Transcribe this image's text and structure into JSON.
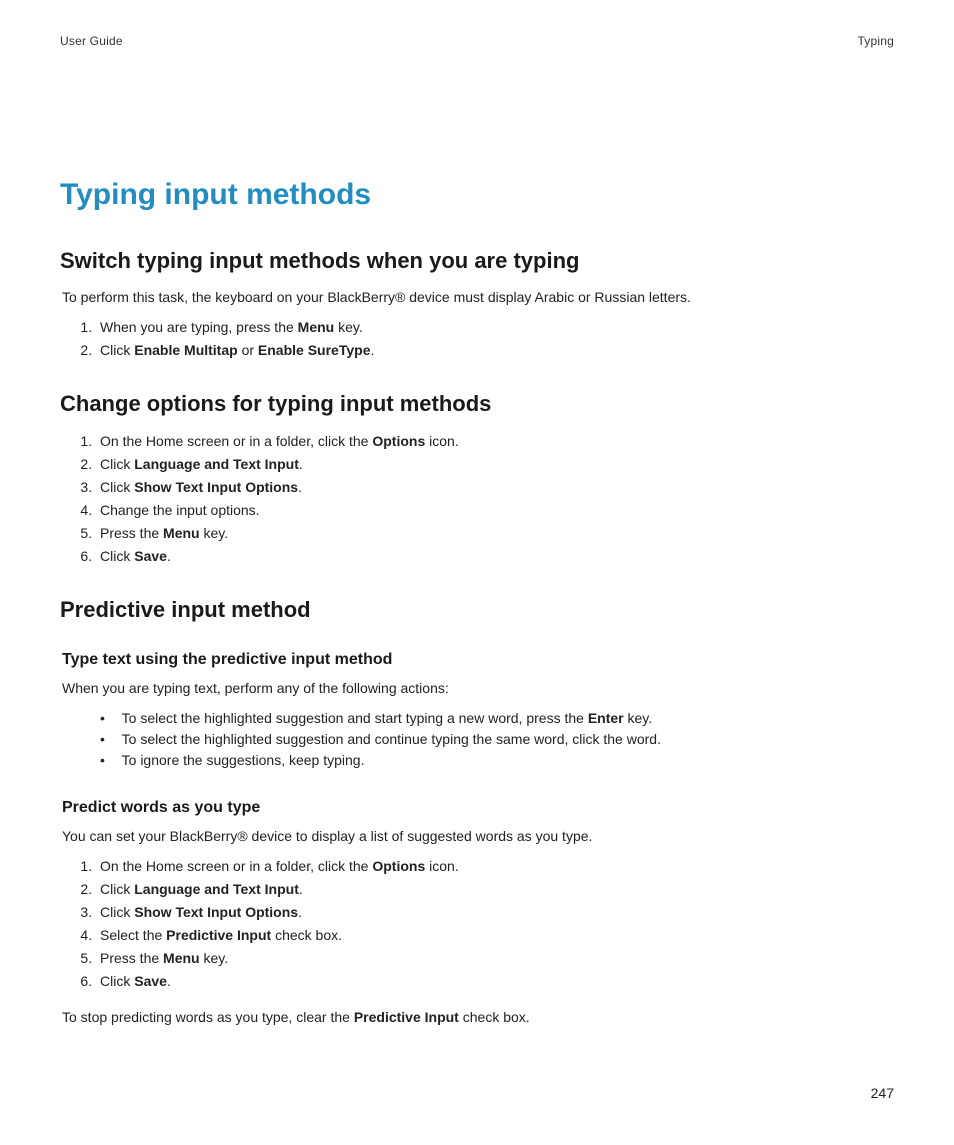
{
  "header": {
    "left": "User Guide",
    "right": "Typing"
  },
  "title": "Typing input methods",
  "sections": {
    "switch": {
      "heading": "Switch typing input methods when you are typing",
      "intro": "To perform this task, the keyboard on your BlackBerry® device must display Arabic or Russian letters.",
      "steps": [
        {
          "pre": "When you are typing, press the ",
          "b1": "Menu",
          "post": " key."
        },
        {
          "pre": "Click ",
          "b1": "Enable Multitap",
          "mid": " or ",
          "b2": "Enable SureType",
          "post": "."
        }
      ]
    },
    "change": {
      "heading": "Change options for typing input methods",
      "steps": [
        {
          "pre": "On the Home screen or in a folder, click the ",
          "b1": "Options",
          "post": " icon."
        },
        {
          "pre": "Click ",
          "b1": "Language and Text Input",
          "post": "."
        },
        {
          "pre": "Click ",
          "b1": "Show Text Input Options",
          "post": "."
        },
        {
          "pre": "Change the input options."
        },
        {
          "pre": "Press the ",
          "b1": "Menu",
          "post": " key."
        },
        {
          "pre": "Click ",
          "b1": "Save",
          "post": "."
        }
      ]
    },
    "predictive": {
      "heading": "Predictive input method",
      "typetext": {
        "heading": "Type text using the predictive input method",
        "intro": "When you are typing text, perform any of the following actions:",
        "bullets": [
          {
            "pre": "To select the highlighted suggestion and start typing a new word, press the ",
            "b1": "Enter",
            "post": " key."
          },
          {
            "pre": "To select the highlighted suggestion and continue typing the same word, click the word."
          },
          {
            "pre": "To ignore the suggestions, keep typing."
          }
        ]
      },
      "predictwords": {
        "heading": "Predict words as you type",
        "intro": "You can set your BlackBerry® device to display a list of suggested words as you type.",
        "steps": [
          {
            "pre": "On the Home screen or in a folder, click the ",
            "b1": "Options",
            "post": " icon."
          },
          {
            "pre": "Click ",
            "b1": "Language and Text Input",
            "post": "."
          },
          {
            "pre": "Click ",
            "b1": "Show Text Input Options",
            "post": "."
          },
          {
            "pre": "Select the ",
            "b1": "Predictive Input",
            "post": " check box."
          },
          {
            "pre": "Press the ",
            "b1": "Menu",
            "post": " key."
          },
          {
            "pre": "Click ",
            "b1": "Save",
            "post": "."
          }
        ],
        "outro": {
          "pre": "To stop predicting words as you type, clear the ",
          "b1": "Predictive Input",
          "post": " check box."
        }
      }
    }
  },
  "page_number": "247"
}
